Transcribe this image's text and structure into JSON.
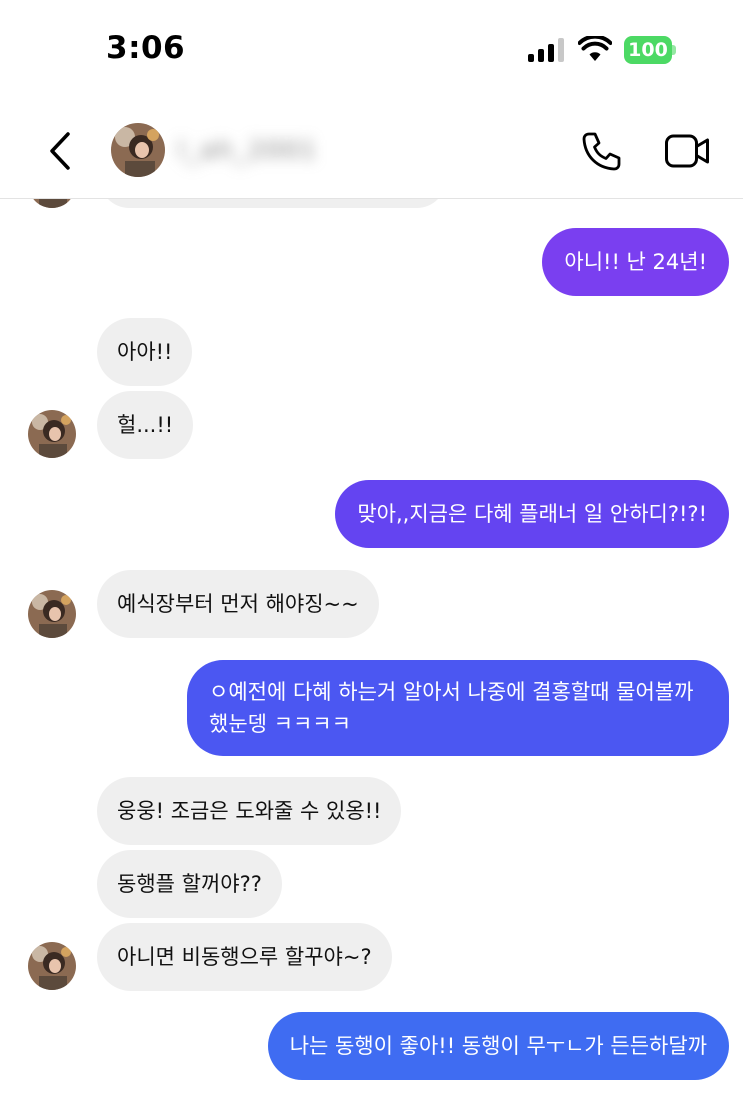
{
  "status_bar": {
    "time": "3:06",
    "battery": "100"
  },
  "header": {
    "username": "l_ah_2001"
  },
  "messages": [
    {
      "from": "me",
      "text": "아니!! 난 24년!"
    },
    {
      "from": "them",
      "text": "아아!!"
    },
    {
      "from": "them",
      "text": "헐...!!"
    },
    {
      "from": "me",
      "text": "맞아,,지금은 다혜 플래너 일 안하디?!?!"
    },
    {
      "from": "them",
      "text": "예식장부터 먼저 해야징~~"
    },
    {
      "from": "me",
      "text": "ㅇ예전에 다혜 하는거 알아서 나중에 결홍할때 물어볼까 했눈뎅 ㅋㅋㅋㅋ"
    },
    {
      "from": "them",
      "text": "웅웅! 조금은 도와줄 수 있옹!!"
    },
    {
      "from": "them",
      "text": "동행플 할꺼야??"
    },
    {
      "from": "them",
      "text": "아니면 비동행으루 할꾸야~?"
    },
    {
      "from": "me",
      "text": "나는 동행이 좋아!! 동행이 무ㅜㄴ가 든든하달까"
    }
  ],
  "colors": {
    "outgoing_top": "#7b3ff0",
    "outgoing_bottom": "#3f6cf2",
    "incoming": "#efefef",
    "battery": "#4cd964"
  },
  "icons": [
    "chevron-left-icon",
    "phone-icon",
    "video-camera-icon",
    "signal-icon",
    "wifi-icon",
    "battery-icon"
  ]
}
